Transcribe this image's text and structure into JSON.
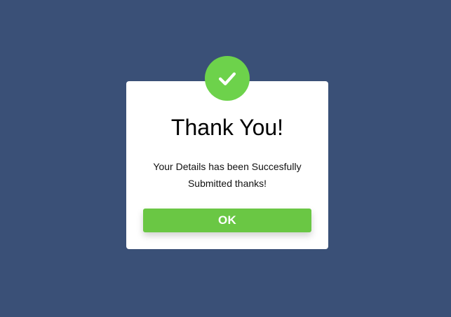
{
  "colors": {
    "background": "#3a5077",
    "modal": "#ffffff",
    "success": "#6dd24b",
    "button": "#6ac744",
    "button_text": "#ffffff"
  },
  "icon": {
    "name": "checkmark-icon"
  },
  "dialog": {
    "title": "Thank You!",
    "message_line_1": "Your Details has been Succesfully",
    "message_line_2": "Submitted thanks!",
    "ok_label": "OK"
  }
}
